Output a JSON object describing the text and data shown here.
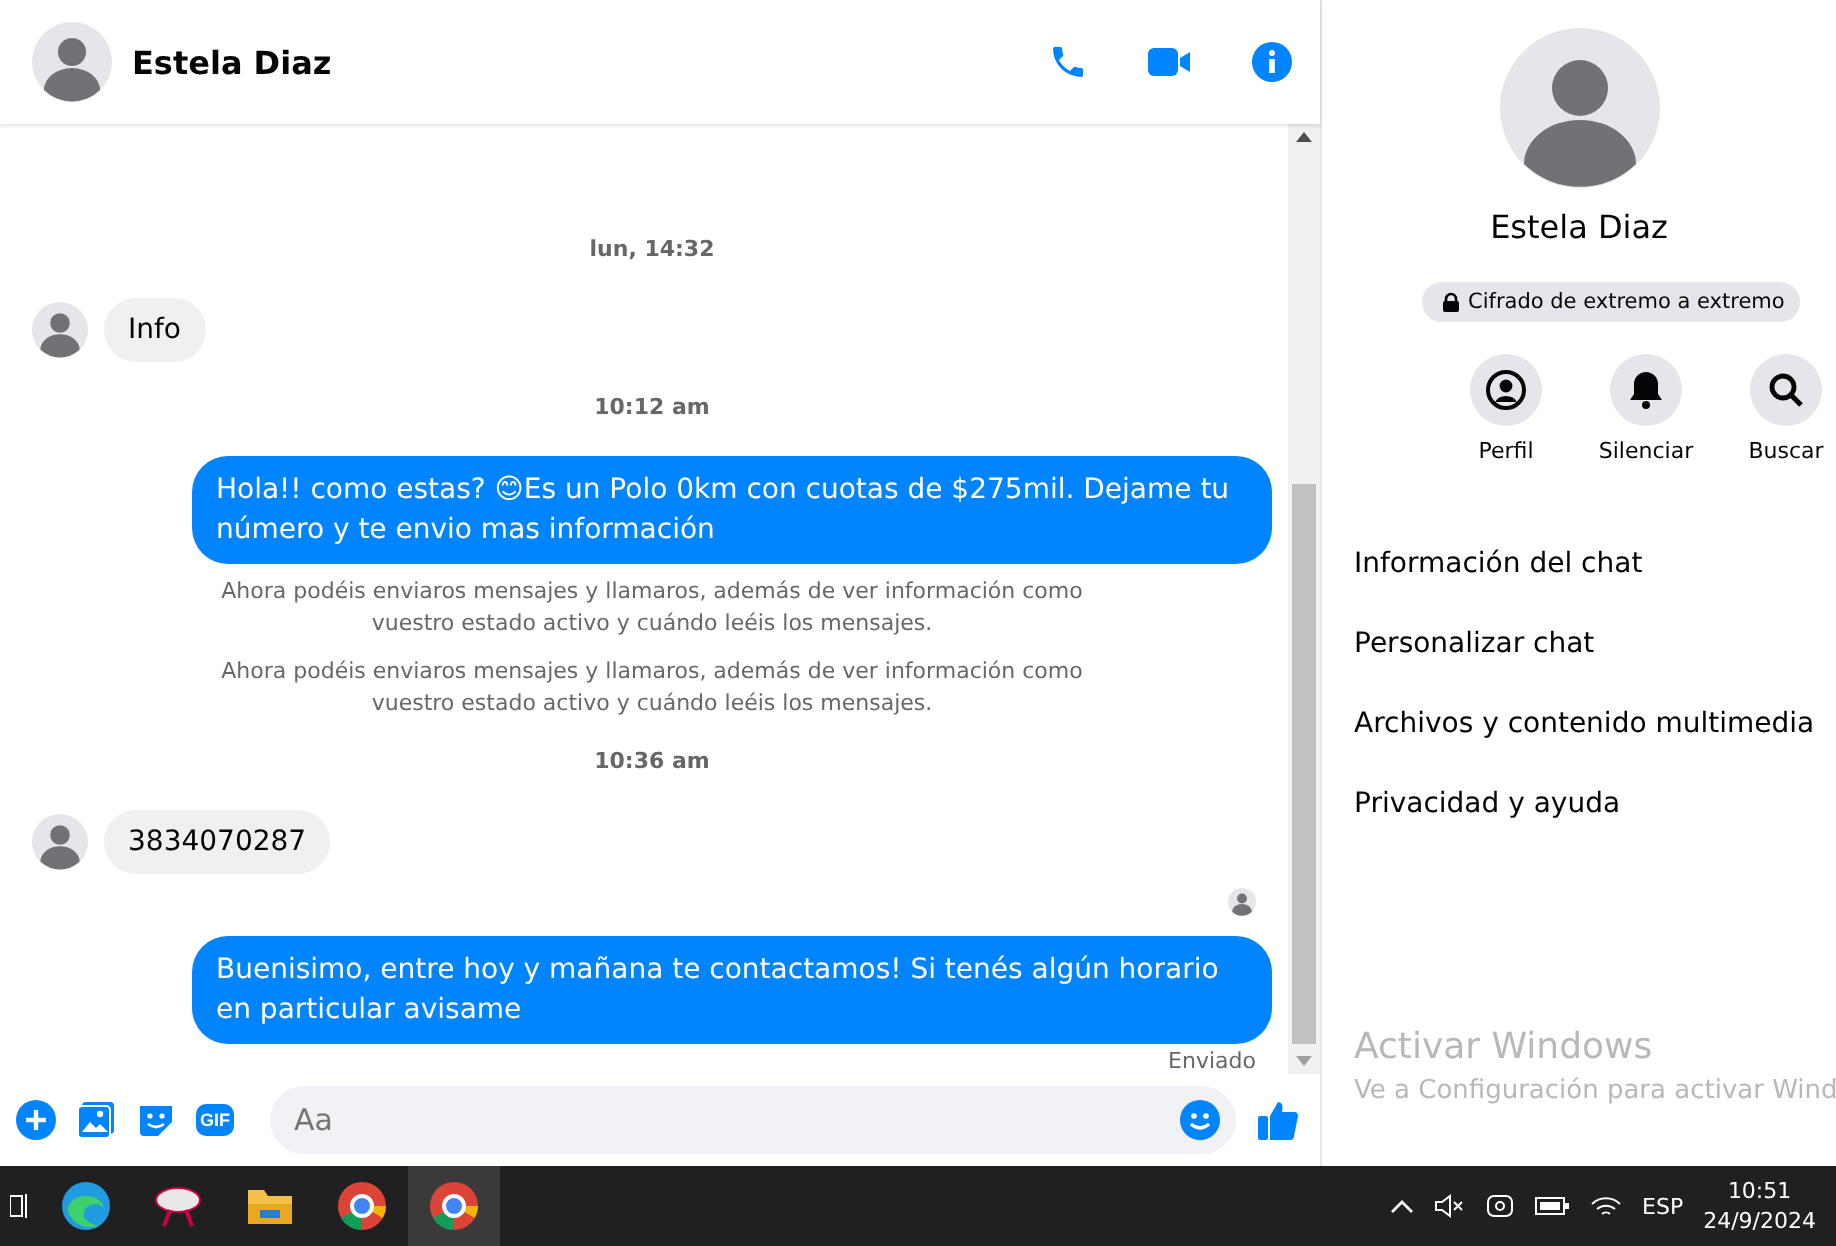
{
  "chat": {
    "contact": "Estela Diaz",
    "messages": [
      {
        "kind": "time",
        "text": "lun, 14:32"
      },
      {
        "kind": "in",
        "text": "Info"
      },
      {
        "kind": "time",
        "text": "10:12 am"
      },
      {
        "kind": "out",
        "text": "Hola!! como estas? 😊Es un Polo 0km con cuotas de $275mil. Dejame tu número y te envio mas información"
      },
      {
        "kind": "notice",
        "text": "Ahora podéis enviaros mensajes y llamaros, además de ver información como vuestro estado activo y cuándo leéis los mensajes."
      },
      {
        "kind": "notice",
        "text": "Ahora podéis enviaros mensajes y llamaros, además de ver información como vuestro estado activo y cuándo leéis los mensajes."
      },
      {
        "kind": "time",
        "text": "10:36 am"
      },
      {
        "kind": "in",
        "text": "3834070287"
      },
      {
        "kind": "seen"
      },
      {
        "kind": "out",
        "text": "Buenisimo, entre hoy y mañana te contactamos! Si tenés algún horario en particular avisame"
      },
      {
        "kind": "status",
        "text": "Enviado"
      }
    ],
    "composer": {
      "placeholder": "Aa",
      "gif": "GIF"
    }
  },
  "info": {
    "name": "Estela Diaz",
    "encryption": "Cifrado de extremo a extremo",
    "actions": [
      "Perfil",
      "Silenciar",
      "Buscar"
    ],
    "sections": [
      "Información del chat",
      "Personalizar chat",
      "Archivos y contenido multimedia",
      "Privacidad y ayuda"
    ],
    "activation": {
      "title": "Activar Windows",
      "subtitle": "Ve a Configuración para activar Wind"
    }
  },
  "taskbar": {
    "language": "ESP",
    "time": "10:51",
    "date": "24/9/2024"
  }
}
